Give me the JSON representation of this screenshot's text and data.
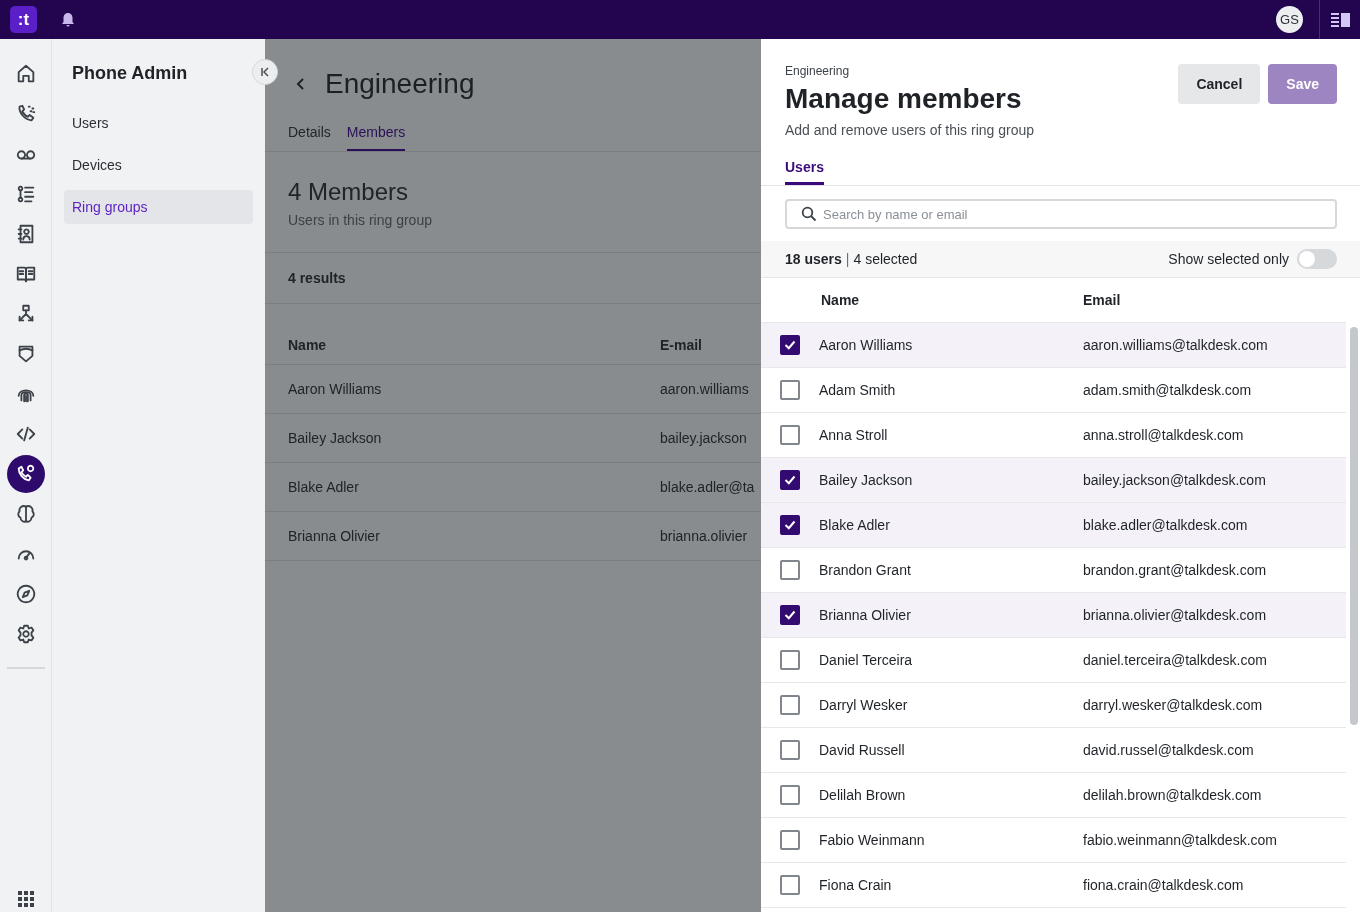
{
  "topbar": {
    "logo": ":t",
    "avatar": "GS"
  },
  "rail": {
    "items": [
      {
        "kind": "home",
        "selected": false
      },
      {
        "kind": "calls",
        "selected": false
      },
      {
        "kind": "voicemail",
        "selected": false
      },
      {
        "kind": "list",
        "selected": false
      },
      {
        "kind": "contacts",
        "selected": false
      },
      {
        "kind": "book",
        "selected": false
      },
      {
        "kind": "flow",
        "selected": false
      },
      {
        "kind": "shield",
        "selected": false
      },
      {
        "kind": "fingerprint",
        "selected": false
      },
      {
        "kind": "code",
        "selected": false
      },
      {
        "kind": "phone-gear",
        "selected": true
      },
      {
        "kind": "brain",
        "selected": false
      },
      {
        "kind": "gauge",
        "selected": false
      },
      {
        "kind": "compass",
        "selected": false
      },
      {
        "kind": "gear",
        "selected": false
      }
    ]
  },
  "sidebar": {
    "title": "Phone Admin",
    "items": [
      {
        "label": "Users",
        "selected": false
      },
      {
        "label": "Devices",
        "selected": false
      },
      {
        "label": "Ring groups",
        "selected": true
      }
    ]
  },
  "main": {
    "title": "Engineering",
    "tabs": [
      {
        "label": "Details",
        "selected": false
      },
      {
        "label": "Members",
        "selected": true
      }
    ],
    "section_title": "4 Members",
    "section_subtitle": "Users in this ring group",
    "results": "4 results",
    "columns": [
      "Name",
      "E-mail"
    ],
    "rows": [
      {
        "name": "Aaron Williams",
        "email": "aaron.williams"
      },
      {
        "name": "Bailey Jackson",
        "email": "bailey.jackson"
      },
      {
        "name": "Blake Adler",
        "email": "blake.adler@ta"
      },
      {
        "name": "Brianna Olivier",
        "email": "brianna.olivier"
      }
    ]
  },
  "panel": {
    "eyebrow": "Engineering",
    "title": "Manage members",
    "subtitle": "Add and remove users of this ring group",
    "buttons": [
      {
        "label": "Cancel",
        "kind": "secondary",
        "disabled": false
      },
      {
        "label": "Save",
        "kind": "primary",
        "disabled": true
      }
    ],
    "tabs": [
      {
        "label": "Users",
        "selected": true
      }
    ],
    "search": {
      "placeholder": "Search by name or email"
    },
    "summary": {
      "count": "18 users",
      "separator": "|",
      "selected": "4 selected"
    },
    "toggle": {
      "label": "Show selected only",
      "on": false
    },
    "columns": [
      "Name",
      "Email"
    ],
    "rows": [
      {
        "name": "Aaron Williams",
        "email": "aaron.williams@talkdesk.com",
        "checked": true
      },
      {
        "name": "Adam Smith",
        "email": "adam.smith@talkdesk.com",
        "checked": false
      },
      {
        "name": "Anna Stroll",
        "email": "anna.stroll@talkdesk.com",
        "checked": false
      },
      {
        "name": "Bailey Jackson",
        "email": "bailey.jackson@talkdesk.com",
        "checked": true
      },
      {
        "name": "Blake Adler",
        "email": "blake.adler@talkdesk.com",
        "checked": true
      },
      {
        "name": "Brandon Grant",
        "email": "brandon.grant@talkdesk.com",
        "checked": false
      },
      {
        "name": "Brianna Olivier",
        "email": "brianna.olivier@talkdesk.com",
        "checked": true
      },
      {
        "name": "Daniel Terceira",
        "email": "daniel.terceira@talkdesk.com",
        "checked": false
      },
      {
        "name": "Darryl Wesker",
        "email": "darryl.wesker@talkdesk.com",
        "checked": false
      },
      {
        "name": "David Russell",
        "email": "david.russel@talkdesk.com",
        "checked": false
      },
      {
        "name": "Delilah Brown",
        "email": "delilah.brown@talkdesk.com",
        "checked": false
      },
      {
        "name": "Fabio Weinmann",
        "email": "fabio.weinmann@talkdesk.com",
        "checked": false
      },
      {
        "name": "Fiona Crain",
        "email": "fiona.crain@talkdesk.com",
        "checked": false
      }
    ]
  }
}
